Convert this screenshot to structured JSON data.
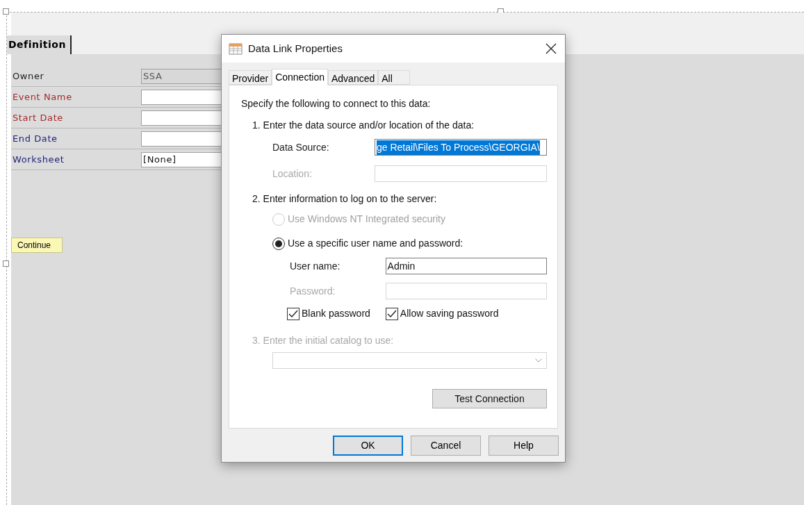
{
  "form": {
    "tab": {
      "label": "Definition",
      "selected": true
    },
    "fields": [
      {
        "label": "Owner",
        "color": "#202020",
        "value": "SSA",
        "disabled": true
      },
      {
        "label": "Event Name",
        "color": "#a52a2a",
        "disabled": false
      },
      {
        "label": "Start Date",
        "color": "#a52a2a",
        "disabled": false
      },
      {
        "label": "End Date",
        "color": "#1f1f7a",
        "disabled": false
      },
      {
        "label": "Worksheet",
        "color": "#1f1f7a",
        "value": "[None]",
        "disabled": false
      }
    ],
    "continue_button": "Continue"
  },
  "dialog": {
    "title": "Data Link Properties",
    "tabs": [
      {
        "label": "Provider",
        "selected": false
      },
      {
        "label": "Connection",
        "selected": true
      },
      {
        "label": "Advanced",
        "selected": false
      },
      {
        "label": "All",
        "selected": false
      }
    ],
    "intro": "Specify the following to connect to this data:",
    "step1": "1. Enter the data source and/or location of the data:",
    "data_source": {
      "label": "Data Source:",
      "value": "ge Retail\\Files To Process\\GEORGIA\\",
      "disabled": false,
      "selected": true
    },
    "location": {
      "label": "Location:",
      "disabled": true
    },
    "step2": "2. Enter information to log on to the server:",
    "radios": [
      {
        "label": "Use Windows NT Integrated security",
        "selected": false,
        "disabled": true
      },
      {
        "label": "Use a specific user name and password:",
        "selected": true,
        "disabled": false
      }
    ],
    "user_name": {
      "label": "User name:",
      "value": "Admin",
      "disabled": false
    },
    "password": {
      "label": "Password:",
      "disabled": true
    },
    "checkboxes": [
      {
        "label": "Blank password",
        "checked": true
      },
      {
        "label": "Allow saving password",
        "checked": true
      }
    ],
    "step3": {
      "label": "3. Enter the initial catalog to use:",
      "disabled": true
    },
    "test_button": "Test Connection",
    "buttons": [
      {
        "label": "OK",
        "default": true
      },
      {
        "label": "Cancel",
        "default": false
      },
      {
        "label": "Help",
        "default": false
      }
    ]
  }
}
